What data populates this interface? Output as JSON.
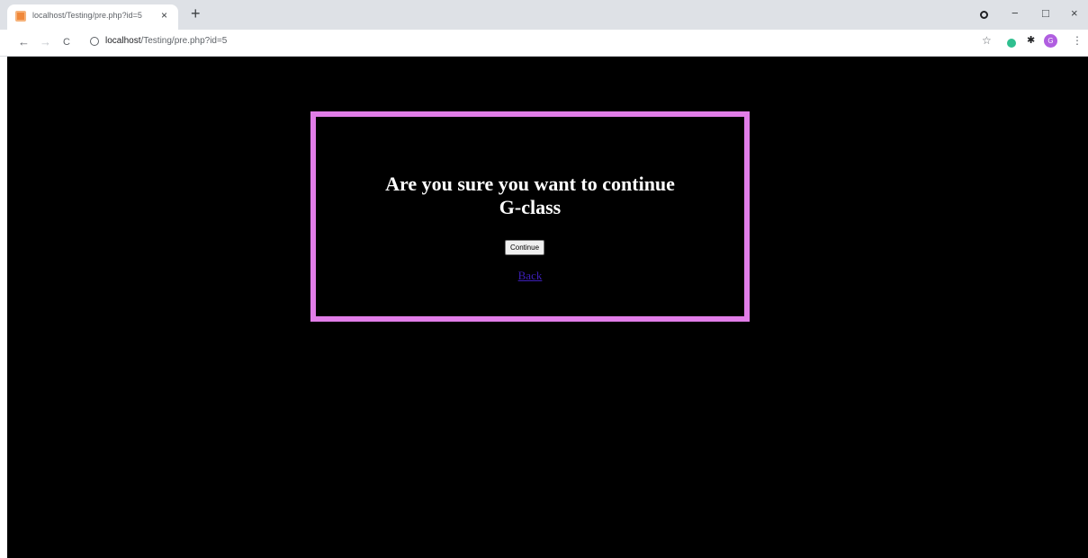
{
  "browser": {
    "tab": {
      "title": "localhost/Testing/pre.php?id=5",
      "favicon": "html-file-icon",
      "close_glyph": "×"
    },
    "new_tab_glyph": "+",
    "window_controls": {
      "minimize": "−",
      "maximize": "□",
      "close": "×"
    },
    "toolbar": {
      "back": "←",
      "forward": "→",
      "reload": "C",
      "url_host": "localhost",
      "url_path": "/Testing/pre.php?id=5",
      "bookmark_glyph": "☆",
      "extensions_glyph": "✱",
      "avatar_letter": "G",
      "menu_glyph": "⋮"
    }
  },
  "page": {
    "heading_line1": "Are you sure you want to continue",
    "heading_line2": "G-class",
    "continue_label": "Continue",
    "back_label": "Back"
  },
  "colors": {
    "page_background": "#000000",
    "dialog_border": "#e17de8",
    "heading_text": "#ffffff",
    "link": "#3d1fb8"
  }
}
